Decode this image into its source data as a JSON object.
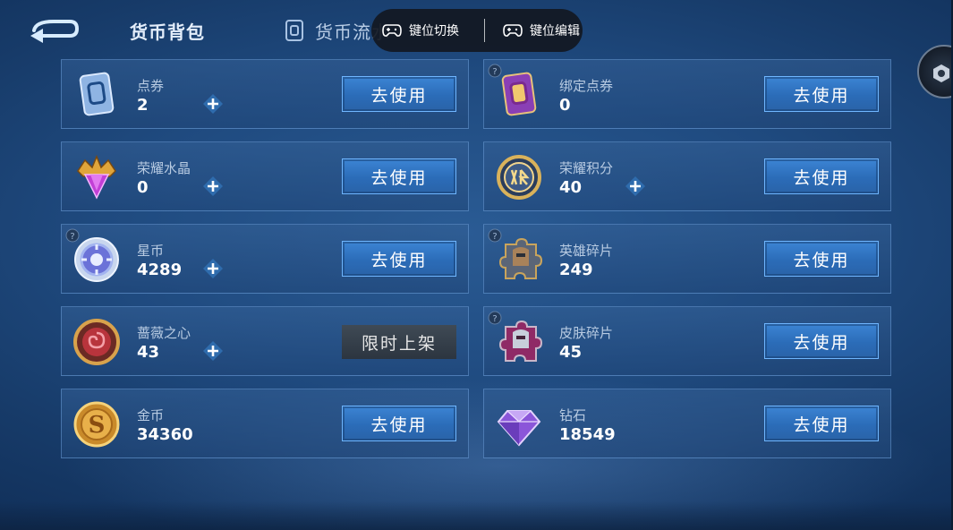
{
  "header": {
    "tabs": [
      {
        "label": "货币背包",
        "active": true
      },
      {
        "label": "货币流水",
        "active": false
      }
    ]
  },
  "keymap": {
    "switch_label": "键位切换",
    "edit_label": "键位编辑"
  },
  "currencies": [
    {
      "name": "点券",
      "amount": "2",
      "icon": "voucher-card-icon",
      "has_plus": true,
      "button": "去使用",
      "has_help": false
    },
    {
      "name": "绑定点券",
      "amount": "0",
      "icon": "bound-voucher-card-icon",
      "has_plus": false,
      "button": "去使用",
      "has_help": true
    },
    {
      "name": "荣耀水晶",
      "amount": "0",
      "icon": "glory-crystal-icon",
      "has_plus": true,
      "button": "去使用",
      "has_help": false
    },
    {
      "name": "荣耀积分",
      "amount": "40",
      "icon": "glory-points-icon",
      "has_plus": true,
      "button": "去使用",
      "has_help": false
    },
    {
      "name": "星币",
      "amount": "4289",
      "icon": "star-coin-icon",
      "has_plus": true,
      "button": "去使用",
      "has_help": true
    },
    {
      "name": "英雄碎片",
      "amount": "249",
      "icon": "hero-fragment-icon",
      "has_plus": false,
      "button": "去使用",
      "has_help": true
    },
    {
      "name": "蔷薇之心",
      "amount": "43",
      "icon": "rose-heart-icon",
      "has_plus": true,
      "button": "限时上架",
      "has_help": false
    },
    {
      "name": "皮肤碎片",
      "amount": "45",
      "icon": "skin-fragment-icon",
      "has_plus": false,
      "button": "去使用",
      "has_help": true
    },
    {
      "name": "金币",
      "amount": "34360",
      "icon": "gold-coin-icon",
      "has_plus": false,
      "button": "去使用",
      "has_help": false
    },
    {
      "name": "钻石",
      "amount": "18549",
      "icon": "diamond-icon",
      "has_plus": false,
      "button": "去使用",
      "has_help": false
    }
  ],
  "colors": {
    "use_button": "#2f72c0",
    "limited_button": "#36404b",
    "card_border": "#78aae6"
  }
}
